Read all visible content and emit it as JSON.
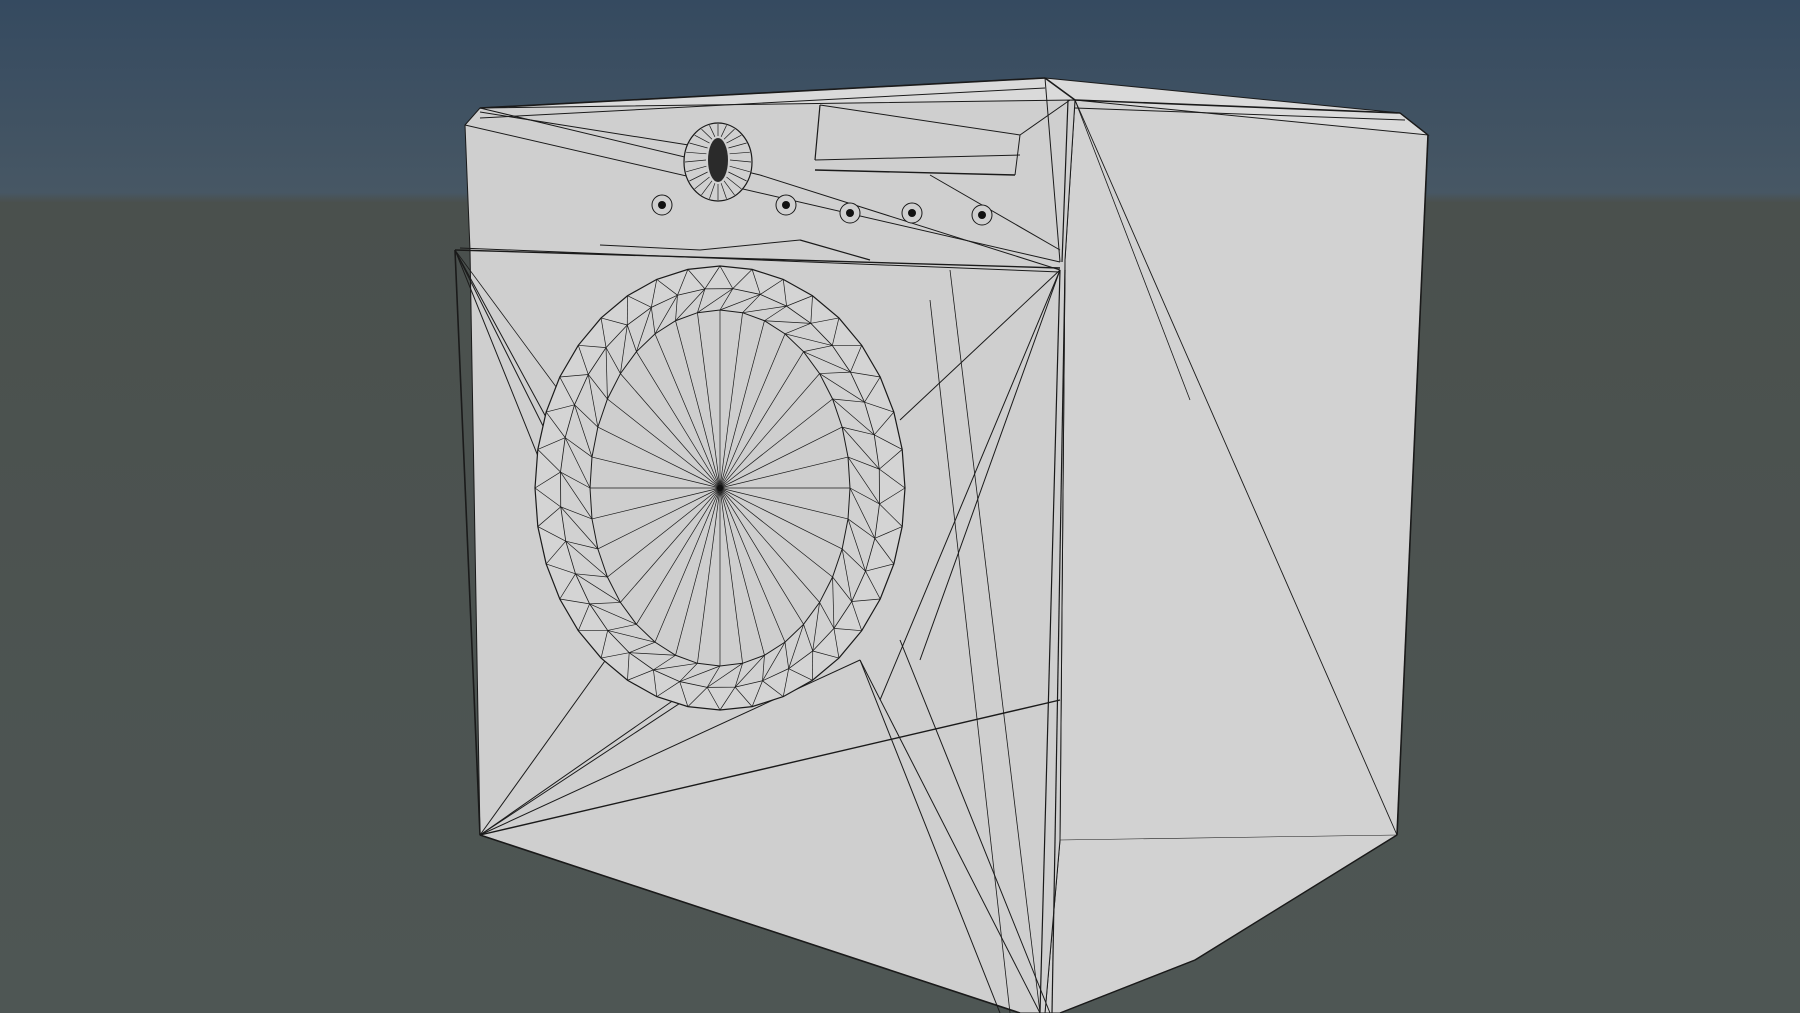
{
  "scene": {
    "subject": "washing-machine-wireframe",
    "render_mode": "shaded-wireframe",
    "colors": {
      "sky_top": "#354a60",
      "sky_horizon": "#475764",
      "ground_near": "#4e5654",
      "ground_far": "#4a504d",
      "panel_front": "#cfcfcf",
      "panel_side": "#d2d2d2",
      "panel_top": "#dadada",
      "wire": "#1a1a1a",
      "knob_dark": "#111111"
    }
  }
}
